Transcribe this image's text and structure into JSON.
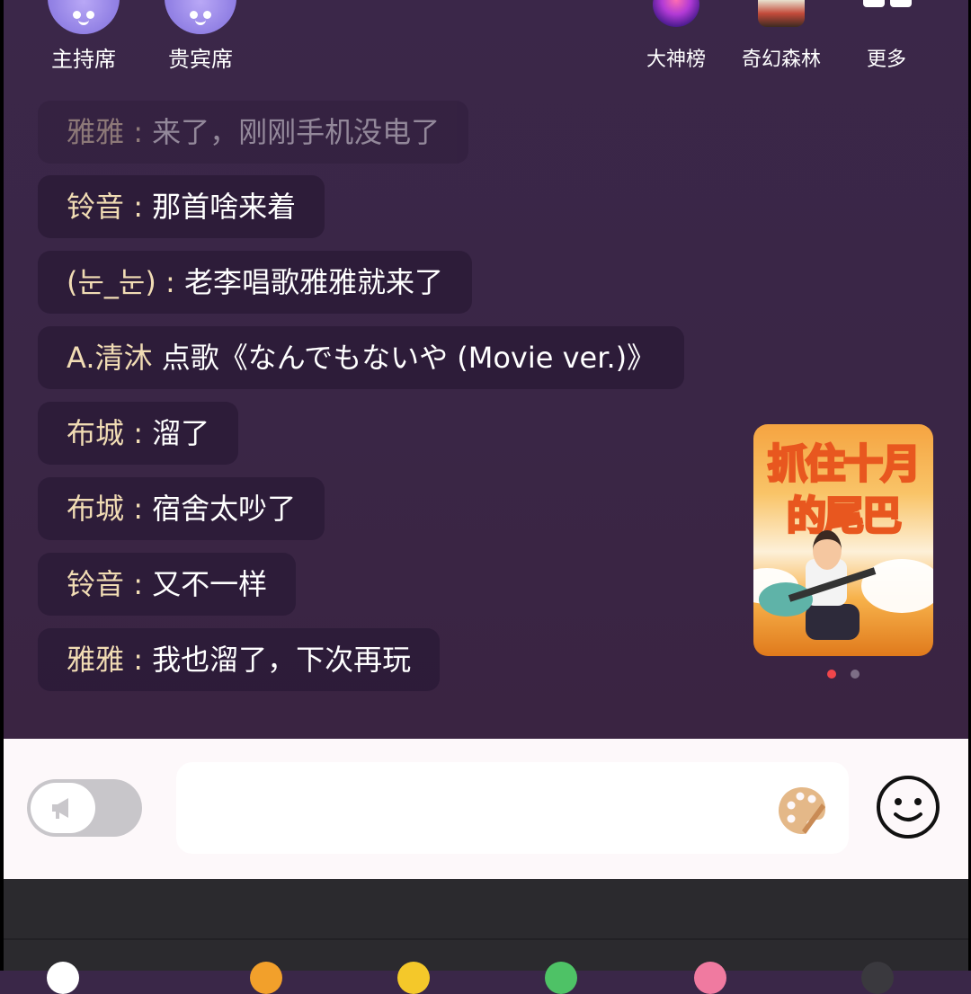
{
  "seats": [
    {
      "label": "主持席"
    },
    {
      "label": "贵宾席"
    }
  ],
  "tools": [
    {
      "label": "大神榜",
      "icon": "leaderboard-icon"
    },
    {
      "label": "奇幻森林",
      "icon": "fantasy-forest-icon"
    },
    {
      "label": "更多",
      "icon": "more-grid-icon"
    }
  ],
  "messages": [
    {
      "name": "雅雅",
      "sep": " : ",
      "text": "来了，刚刚手机没电了"
    },
    {
      "name": "铃音",
      "sep": " : ",
      "text": "那首啥来着"
    },
    {
      "name": "(눈_눈)",
      "sep": " : ",
      "text": "老李唱歌雅雅就来了"
    },
    {
      "name": "A.清沐",
      "sep": " ",
      "text": "点歌《なんでもないや (Movie ver.)》"
    },
    {
      "name": "布城",
      "sep": " : ",
      "text": "溜了"
    },
    {
      "name": "布城",
      "sep": " : ",
      "text": "宿舍太吵了"
    },
    {
      "name": "铃音",
      "sep": " : ",
      "text": "又不一样"
    },
    {
      "name": "雅雅",
      "sep": " : ",
      "text": "我也溜了，下次再玩"
    }
  ],
  "banner": {
    "line1": "抓住十月",
    "line2": "的尾巴",
    "page_active": 1,
    "page_count": 2
  },
  "input": {
    "placeholder": "",
    "value": ""
  },
  "colors": {
    "background": "#3a2748",
    "bubble": "#2c1b38",
    "name_text": "#f1dcb4",
    "accent_dot": "#f0464b",
    "input_bar": "#fdf8fa",
    "palette_icon": "#e4b888"
  }
}
